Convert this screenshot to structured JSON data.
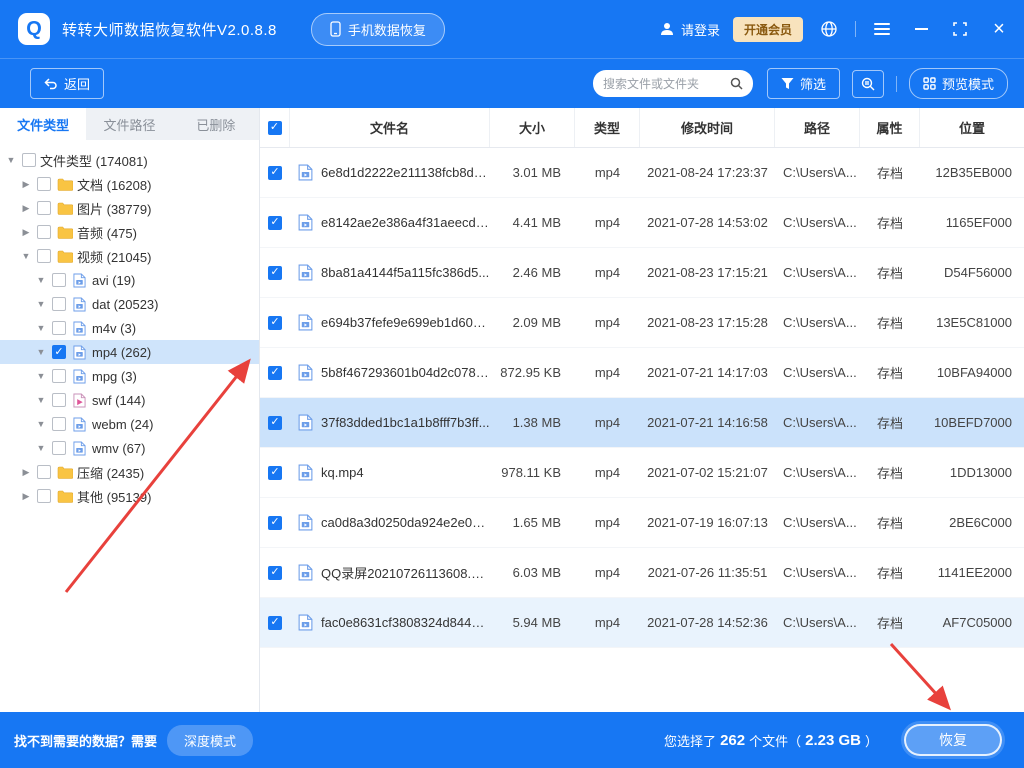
{
  "colors": {
    "primary": "#1777f3",
    "selected_row": "#cbe2fb",
    "hover_row": "#e9f3fd",
    "tree_selected": "#cfe4fb",
    "vip_bg": "#f8e3bd",
    "vip_text": "#8a5a10",
    "annotation_red": "#e8413c"
  },
  "icons": {
    "logo_glyph": "Q",
    "check_glyph": "✓",
    "expanded_arrow": "▼",
    "collapsed_arrow": "▶"
  },
  "titlebar": {
    "app_title": "转转大师数据恢复软件V2.0.8.8",
    "phone_recovery_button": "手机数据恢复",
    "login_label": "请登录",
    "vip_button": "开通会员"
  },
  "toolbar": {
    "back_button": "返回",
    "search_placeholder": "搜索文件或文件夹",
    "filter_button": "筛选",
    "preview_button": "预览模式"
  },
  "sidebar": {
    "tabs": [
      {
        "label": "文件类型",
        "active": true
      },
      {
        "label": "文件路径",
        "active": false
      },
      {
        "label": "已删除",
        "active": false
      }
    ],
    "tree": [
      {
        "name": "文件类型",
        "count": "174081",
        "level": 0,
        "arrow": "down",
        "check": "unchecked",
        "icon": "none",
        "selected": false
      },
      {
        "name": "文档",
        "count": "16208",
        "level": 1,
        "arrow": "right",
        "check": "unchecked",
        "icon": "folder",
        "selected": false
      },
      {
        "name": "图片",
        "count": "38779",
        "level": 1,
        "arrow": "right",
        "check": "unchecked",
        "icon": "folder",
        "selected": false
      },
      {
        "name": "音频",
        "count": "475",
        "level": 1,
        "arrow": "right",
        "check": "unchecked",
        "icon": "folder",
        "selected": false
      },
      {
        "name": "视频",
        "count": "21045",
        "level": 1,
        "arrow": "down",
        "check": "unchecked",
        "icon": "folder",
        "selected": false
      },
      {
        "name": "avi",
        "count": "19",
        "level": 2,
        "arrow": "down",
        "check": "unchecked",
        "icon": "media",
        "selected": false
      },
      {
        "name": "dat",
        "count": "20523",
        "level": 2,
        "arrow": "down",
        "check": "unchecked",
        "icon": "media",
        "selected": false
      },
      {
        "name": "m4v",
        "count": "3",
        "level": 2,
        "arrow": "down",
        "check": "unchecked",
        "icon": "media",
        "selected": false
      },
      {
        "name": "mp4",
        "count": "262",
        "level": 2,
        "arrow": "down",
        "check": "checked",
        "icon": "media",
        "selected": true
      },
      {
        "name": "mpg",
        "count": "3",
        "level": 2,
        "arrow": "down",
        "check": "unchecked",
        "icon": "media",
        "selected": false
      },
      {
        "name": "swf",
        "count": "144",
        "level": 2,
        "arrow": "down",
        "check": "unchecked",
        "icon": "swf",
        "selected": false
      },
      {
        "name": "webm",
        "count": "24",
        "level": 2,
        "arrow": "down",
        "check": "unchecked",
        "icon": "media",
        "selected": false
      },
      {
        "name": "wmv",
        "count": "67",
        "level": 2,
        "arrow": "down",
        "check": "unchecked",
        "icon": "media",
        "selected": false
      },
      {
        "name": "压缩",
        "count": "2435",
        "level": 1,
        "arrow": "right",
        "check": "unchecked",
        "icon": "folder",
        "selected": false
      },
      {
        "name": "其他",
        "count": "95139",
        "level": 1,
        "arrow": "right",
        "check": "unchecked",
        "icon": "folder",
        "selected": false
      }
    ]
  },
  "table": {
    "header_checkbox": "checked",
    "headers": [
      "文件名",
      "大小",
      "类型",
      "修改时间",
      "路径",
      "属性",
      "位置"
    ],
    "rows": [
      {
        "name": "6e8d1d2222e211138fcb8dd...",
        "size": "3.01 MB",
        "type": "mp4",
        "modified": "2021-08-24 17:23:37",
        "path": "C:\\Users\\A...",
        "attr": "存档",
        "location": "12B35EB000",
        "highlight": "none"
      },
      {
        "name": "e8142ae2e386a4f31aeecd1...",
        "size": "4.41 MB",
        "type": "mp4",
        "modified": "2021-07-28 14:53:02",
        "path": "C:\\Users\\A...",
        "attr": "存档",
        "location": "1165EF000",
        "highlight": "none"
      },
      {
        "name": "8ba81a4144f5a115fc386d5...",
        "size": "2.46 MB",
        "type": "mp4",
        "modified": "2021-08-23 17:15:21",
        "path": "C:\\Users\\A...",
        "attr": "存档",
        "location": "D54F56000",
        "highlight": "none"
      },
      {
        "name": "e694b37fefe9e699eb1d60d...",
        "size": "2.09 MB",
        "type": "mp4",
        "modified": "2021-08-23 17:15:28",
        "path": "C:\\Users\\A...",
        "attr": "存档",
        "location": "13E5C81000",
        "highlight": "none"
      },
      {
        "name": "5b8f467293601b04d2c0785...",
        "size": "872.95 KB",
        "type": "mp4",
        "modified": "2021-07-21 14:17:03",
        "path": "C:\\Users\\A...",
        "attr": "存档",
        "location": "10BFA94000",
        "highlight": "none"
      },
      {
        "name": "37f83dded1bc1a1b8fff7b3ff...",
        "size": "1.38 MB",
        "type": "mp4",
        "modified": "2021-07-21 14:16:58",
        "path": "C:\\Users\\A...",
        "attr": "存档",
        "location": "10BEFD7000",
        "highlight": "selected"
      },
      {
        "name": "kq.mp4",
        "size": "978.11 KB",
        "type": "mp4",
        "modified": "2021-07-02 15:21:07",
        "path": "C:\\Users\\A...",
        "attr": "存档",
        "location": "1DD13000",
        "highlight": "none"
      },
      {
        "name": "ca0d8a3d0250da924e2e0d...",
        "size": "1.65 MB",
        "type": "mp4",
        "modified": "2021-07-19 16:07:13",
        "path": "C:\\Users\\A...",
        "attr": "存档",
        "location": "2BE6C000",
        "highlight": "none"
      },
      {
        "name": "QQ录屏20210726113608.mp4",
        "size": "6.03 MB",
        "type": "mp4",
        "modified": "2021-07-26 11:35:51",
        "path": "C:\\Users\\A...",
        "attr": "存档",
        "location": "1141EE2000",
        "highlight": "none"
      },
      {
        "name": "fac0e8631cf3808324d84471...",
        "size": "5.94 MB",
        "type": "mp4",
        "modified": "2021-07-28 14:52:36",
        "path": "C:\\Users\\A...",
        "attr": "存档",
        "location": "AF7C05000",
        "highlight": "hover"
      }
    ]
  },
  "statusbar": {
    "hint_text": "找不到需要的数据？需要",
    "deep_mode_button": "深度模式",
    "selected_prefix": "您选择了",
    "selected_count": "262",
    "selected_mid": "个文件（",
    "selected_size": "2.23 GB",
    "selected_suffix": "）",
    "recover_button": "恢复"
  }
}
